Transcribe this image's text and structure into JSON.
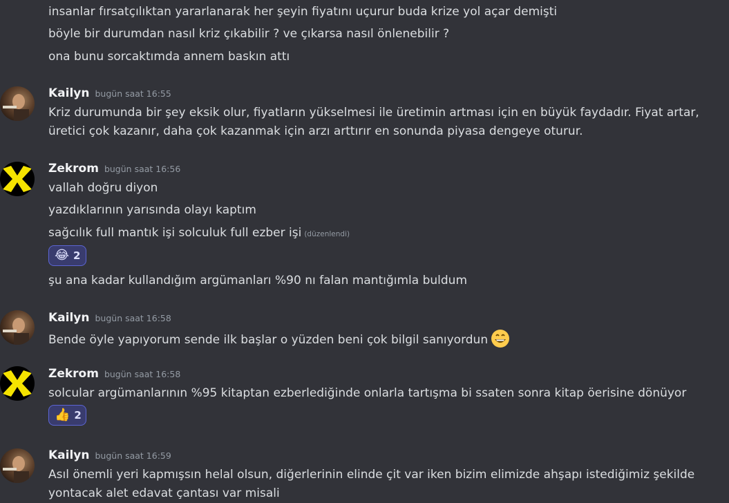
{
  "messages": {
    "top_line1": "insanlar fırsatçılıktan yararlanarak her şeyin fiyatını uçurur buda krize yol açar demişti",
    "top_line2": "böyle bir durumdan nasıl kriz çıkabilir ? ve çıkarsa nasıl önlenebilir ?",
    "top_line3": "ona bunu sorcaktımda annem baskın attı",
    "k1_name": "Kailyn",
    "k1_time": "bugün saat 16:55",
    "k1_line1": "Kriz durumunda bir şey eksik olur, fiyatların yükselmesi ile üretimin artması için en büyük faydadır. Fiyat artar,",
    "k1_line2": "üretici çok kazanır, daha çok kazanmak için arzı arttırır en sonunda piyasa dengeye oturur.",
    "z1_name": "Zekrom",
    "z1_time": "bugün saat 16:56",
    "z1_line1": "vallah doğru diyon",
    "z1_line2": "yazdıklarının yarısında olayı kaptım",
    "z1_line3": "sağcılık full mantık işi solculuk full ezber işi",
    "z1_edited": "(düzenlendi)",
    "z1_reaction_emoji": "😂",
    "z1_reaction_count": "2",
    "z1_line4": "şu ana kadar kullandığım argümanları %90 nı falan mantığımla buldum",
    "k2_name": "Kailyn",
    "k2_time": "bugün saat 16:58",
    "k2_line1": "Bende öyle yapıyorum sende ilk başlar o yüzden beni çok bilgil sanıyordun",
    "z2_name": "Zekrom",
    "z2_time": "bugün saat 16:58",
    "z2_line1": "solcular argümanlarının %95 kitaptan ezberlediğinde onlarla tartışma bi ssaten sonra kitap öerisine dönüyor",
    "z2_reaction_emoji": "👍",
    "z2_reaction_count": "2",
    "k3_name": "Kailyn",
    "k3_time": "bugün saat 16:59",
    "k3_line1": "Asıl önemli yeri kapmışsın helal olsun, diğerlerinin elinde çit var iken bizim elimizde ahşapı istediğimiz şekilde",
    "k3_line2": "yontacak alet edavat çantası var misali"
  },
  "colors": {
    "background": "#323339",
    "text": "#dbdee1",
    "timestamp": "#949ba4",
    "reaction_bg": "#393c6e",
    "reaction_border": "#5c65d4"
  },
  "icons": [
    "avatar-kailyn",
    "avatar-zekrom",
    "smile-emoji"
  ]
}
